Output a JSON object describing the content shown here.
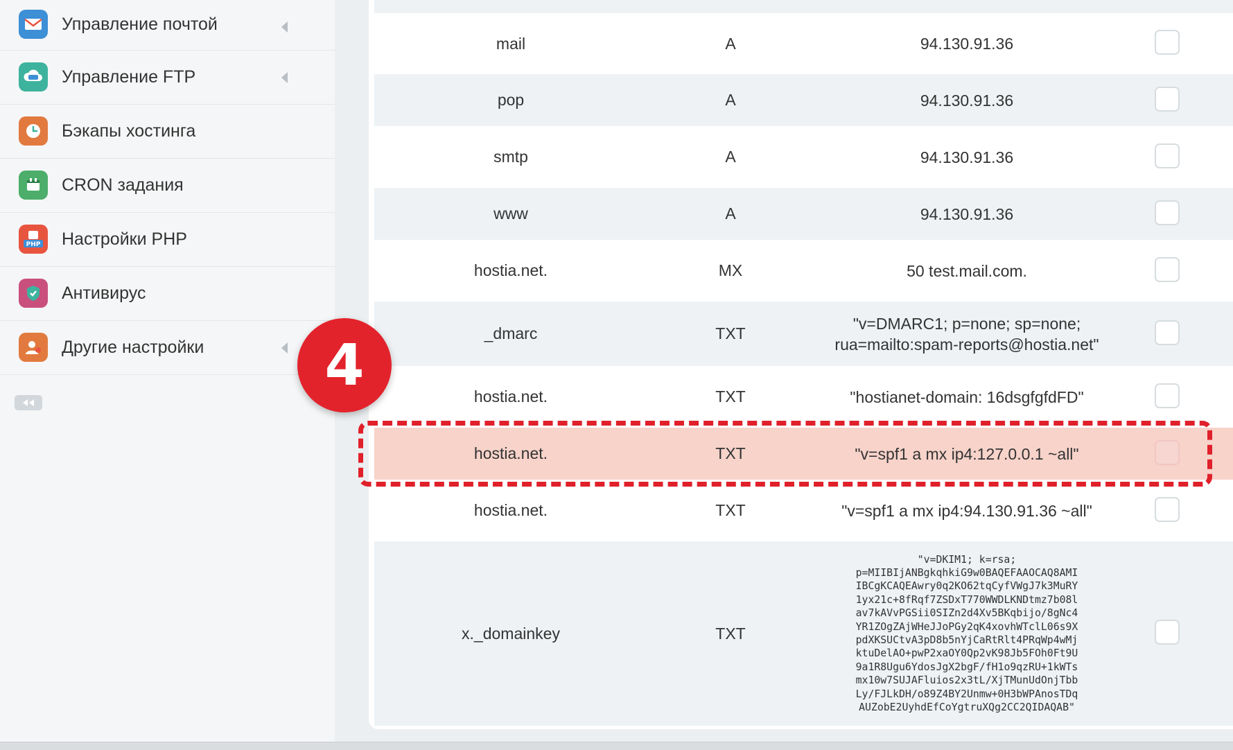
{
  "sidebar": {
    "items": [
      {
        "label": "Управление почтой",
        "icon": "mail-icon",
        "has_chevron": true,
        "color": "#3d8fd6"
      },
      {
        "label": "Управление FTP",
        "icon": "ftp-cloud-icon",
        "has_chevron": true,
        "color": "#3db39e"
      },
      {
        "label": "Бэкапы хостинга",
        "icon": "backup-clock-icon",
        "has_chevron": false,
        "color": "#e27a3f"
      },
      {
        "label": "CRON задания",
        "icon": "calendar-icon",
        "has_chevron": false,
        "color": "#4cae6a"
      },
      {
        "label": "Настройки PHP",
        "icon": "php-icon",
        "has_chevron": false,
        "color": "#3d8fd6"
      },
      {
        "label": "Антивирус",
        "icon": "shield-icon",
        "has_chevron": false,
        "color": "#c94f7c"
      },
      {
        "label": "Другие настройки",
        "icon": "settings-user-icon",
        "has_chevron": true,
        "color": "#e27a3f"
      }
    ]
  },
  "badge": {
    "number": "4",
    "color": "#e3232c"
  },
  "dns_records": [
    {
      "name": "mail",
      "type": "A",
      "value": "94.130.91.36"
    },
    {
      "name": "pop",
      "type": "A",
      "value": "94.130.91.36"
    },
    {
      "name": "smtp",
      "type": "A",
      "value": "94.130.91.36"
    },
    {
      "name": "www",
      "type": "A",
      "value": "94.130.91.36"
    },
    {
      "name": "hostia.net.",
      "type": "MX",
      "value": "50 test.mail.com."
    },
    {
      "name": "_dmarc",
      "type": "TXT",
      "value": "\"v=DMARC1; p=none; sp=none;\nrua=mailto:spam-reports@hostia.net\""
    },
    {
      "name": "hostia.net.",
      "type": "TXT",
      "value": "\"hostianet-domain: 16dsgfgfdFD\""
    },
    {
      "name": "hostia.net.",
      "type": "TXT",
      "value": "\"v=spf1 a mx ip4:127.0.0.1 ~all\"",
      "highlighted": true
    },
    {
      "name": "hostia.net.",
      "type": "TXT",
      "value": "\"v=spf1 a mx ip4:94.130.91.36 ~all\""
    },
    {
      "name": "x._domainkey",
      "type": "TXT",
      "value": "\"v=DKIM1; k=rsa;\np=MIIBIjANBgkqhkiG9w0BAQEFAAOCAQ8AMI\nIBCgKCAQEAwry0q2KO62tqCyfVWgJ7k3MuRY\n1yx21c+8fRqf7ZSDxT770WWDLKNDtmz7b08l\nav7kAVvPGSii0SIZn2d4Xv5BKqbijo/8gNc4\nYR1ZOgZAjWHeJJoPGy2qK4xovhWTclL06s9X\npdXKSUCtvA3pD8b5nYjCaRtRlt4PRqWp4wMj\nktuDelAO+pwP2xaOY0Qp2vK98Jb5FOh0Ft9U\n9a1R8Ugu6YdosJgX2bgF/fH1o9qzRU+1kWTs\nmx10w7SUJAFluios2x3tL/XjTMunUdOnjTbb\nLy/FJLkDH/o89Z4BY2Unmw+0H3bWPAnosTDq\nAUZobE2UyhdEfCoYgtruXQg2CC2QIDAQAB\"",
      "mono": true
    }
  ]
}
